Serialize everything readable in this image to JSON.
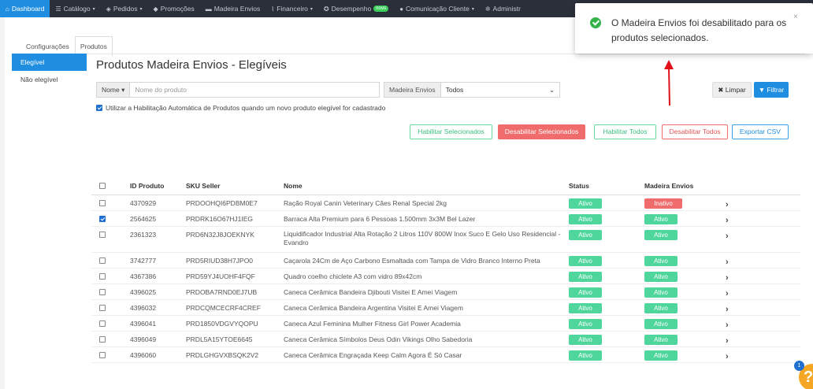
{
  "nav": {
    "items": [
      {
        "label": "Dashboard",
        "icon": "home-icon",
        "glyph": "⌂",
        "caret": false,
        "active": true
      },
      {
        "label": "Catálogo",
        "icon": "list-icon",
        "glyph": "☰",
        "caret": true
      },
      {
        "label": "Pedidos",
        "icon": "layers-icon",
        "glyph": "◈",
        "caret": true
      },
      {
        "label": "Promoções",
        "icon": "tag-icon",
        "glyph": "◆",
        "caret": false
      },
      {
        "label": "Madeira Envios",
        "icon": "truck-icon",
        "glyph": "▬",
        "caret": false
      },
      {
        "label": "Financeiro",
        "icon": "chart-icon",
        "glyph": "⌇",
        "caret": true
      },
      {
        "label": "Desempenho",
        "icon": "gauge-icon",
        "glyph": "✪",
        "caret": false,
        "badge": "novo"
      },
      {
        "label": "Comunicação Cliente",
        "icon": "chat-icon",
        "glyph": "●",
        "caret": true
      },
      {
        "label": "Administr",
        "icon": "gear-icon",
        "glyph": "✲",
        "caret": false
      }
    ]
  },
  "tabs": {
    "config": "Configurações",
    "produtos": "Produtos"
  },
  "leftmenu": {
    "elegivel": "Elegível",
    "nao_elegivel": "Não elegível"
  },
  "title": "Produtos Madeira Envios - Elegíveis",
  "filters": {
    "nome_label": "Nome",
    "nome_placeholder": "Nome do produto",
    "me_label": "Madeira Envios",
    "me_value": "Todos",
    "limpar": "Limpar",
    "filtrar": "Filtrar"
  },
  "auto_check": "Utilizar a Habilitação Automática de Produtos quando um novo produto elegível for cadastrado",
  "actions": {
    "hab_sel": "Habilitar Selecionados",
    "des_sel": "Desabilitar Selecionados",
    "hab_todos": "Habilitar Todos",
    "des_todos": "Desabilitar Todos",
    "exportar": "Exportar CSV"
  },
  "table": {
    "headers": {
      "id": "ID Produto",
      "sku": "SKU Seller",
      "nome": "Nome",
      "status": "Status",
      "me": "Madeira Envios"
    },
    "rows": [
      {
        "id": "4370929",
        "sku": "PRDOOHQI6PDBM0E7",
        "nome": "Ração Royal Canin Veterinary Cães Renal Special 2kg",
        "status": "Ativo",
        "me": "Inativo",
        "checked": false
      },
      {
        "id": "2564625",
        "sku": "PRDRK16O67HJ1IEG",
        "nome": "Barraca Alta Premium para 6 Pessoas 1.500mm 3x3M Bel Lazer",
        "status": "Ativo",
        "me": "Ativo",
        "checked": true
      },
      {
        "id": "2361323",
        "sku": "PRD6N32J8JOEKNYK",
        "nome": "Liquidificador Industrial Alta Rotação 2 Litros 110V 800W Inox Suco E Gelo Uso Residencial - Evandro",
        "status": "Ativo",
        "me": "Ativo",
        "checked": false
      },
      {
        "id": "3742777",
        "sku": "PRD5RIUD38H7JPO0",
        "nome": "Caçarola 24Cm de Aço Carbono Esmaltada com Tampa de Vidro Branco Interno Preta",
        "status": "Ativo",
        "me": "Ativo",
        "checked": false
      },
      {
        "id": "4367386",
        "sku": "PRD59YJ4UOHF4FQF",
        "nome": "Quadro coelho chiclete A3 com vidro 89x42cm",
        "status": "Ativo",
        "me": "Ativo",
        "checked": false
      },
      {
        "id": "4396025",
        "sku": "PRDOBA7RND0EJ7UB",
        "nome": "Caneca Cerâmica Bandeira Djibouti Visitei E Amei Viagem",
        "status": "Ativo",
        "me": "Ativo",
        "checked": false
      },
      {
        "id": "4396032",
        "sku": "PRDCQMCECRF4CREF",
        "nome": "Caneca Cerâmica Bandeira Argentina Visitei E Amei Viagem",
        "status": "Ativo",
        "me": "Ativo",
        "checked": false
      },
      {
        "id": "4396041",
        "sku": "PRD1850VDGVYQOPU",
        "nome": "Caneca Azul Feminina Mulher Fitness Girl Power Academia",
        "status": "Ativo",
        "me": "Ativo",
        "checked": false
      },
      {
        "id": "4396049",
        "sku": "PRDL5A15YTOE6645",
        "nome": "Caneca Cerâmica Símbolos Deus Odin Vikings Olho Sabedoria",
        "status": "Ativo",
        "me": "Ativo",
        "checked": false
      },
      {
        "id": "4396060",
        "sku": "PRDLGHGVXBSQK2V2",
        "nome": "Caneca Cerâmica Engraçada Keep Calm Agora É Só Casar",
        "status": "Ativo",
        "me": "Ativo",
        "checked": false
      }
    ]
  },
  "toast": {
    "message": "O Madeira Envios foi desabilitado para os produtos selecionados.",
    "close": "×"
  },
  "help": {
    "badge": "1",
    "label": "?"
  },
  "colors": {
    "primary": "#1f8ee0",
    "success": "#4fd69c",
    "danger": "#f06b6b",
    "nav_bg": "#2b2f3a",
    "annotation": "#e0101a"
  }
}
